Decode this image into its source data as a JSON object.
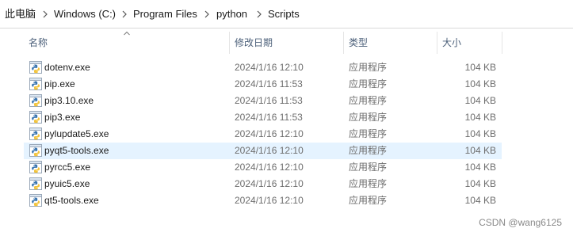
{
  "breadcrumb": [
    "此电脑",
    "Windows (C:)",
    "Program Files",
    "python",
    "Scripts"
  ],
  "columns": {
    "name": "名称",
    "date": "修改日期",
    "type": "类型",
    "size": "大小"
  },
  "files": [
    {
      "name": "dotenv.exe",
      "date": "2024/1/16 12:10",
      "type": "应用程序",
      "size": "104 KB"
    },
    {
      "name": "pip.exe",
      "date": "2024/1/16 11:53",
      "type": "应用程序",
      "size": "104 KB"
    },
    {
      "name": "pip3.10.exe",
      "date": "2024/1/16 11:53",
      "type": "应用程序",
      "size": "104 KB"
    },
    {
      "name": "pip3.exe",
      "date": "2024/1/16 11:53",
      "type": "应用程序",
      "size": "104 KB"
    },
    {
      "name": "pylupdate5.exe",
      "date": "2024/1/16 12:10",
      "type": "应用程序",
      "size": "104 KB"
    },
    {
      "name": "pyqt5-tools.exe",
      "date": "2024/1/16 12:10",
      "type": "应用程序",
      "size": "104 KB"
    },
    {
      "name": "pyrcc5.exe",
      "date": "2024/1/16 12:10",
      "type": "应用程序",
      "size": "104 KB"
    },
    {
      "name": "pyuic5.exe",
      "date": "2024/1/16 12:10",
      "type": "应用程序",
      "size": "104 KB"
    },
    {
      "name": "qt5-tools.exe",
      "date": "2024/1/16 12:10",
      "type": "应用程序",
      "size": "104 KB"
    }
  ],
  "file_icon": "python-exe-icon",
  "watermark": "CSDN @wang6125",
  "colors": {
    "selected_row": "#e5f3ff",
    "header_text": "#4c607a",
    "secondary_text": "#6d6d6d"
  }
}
